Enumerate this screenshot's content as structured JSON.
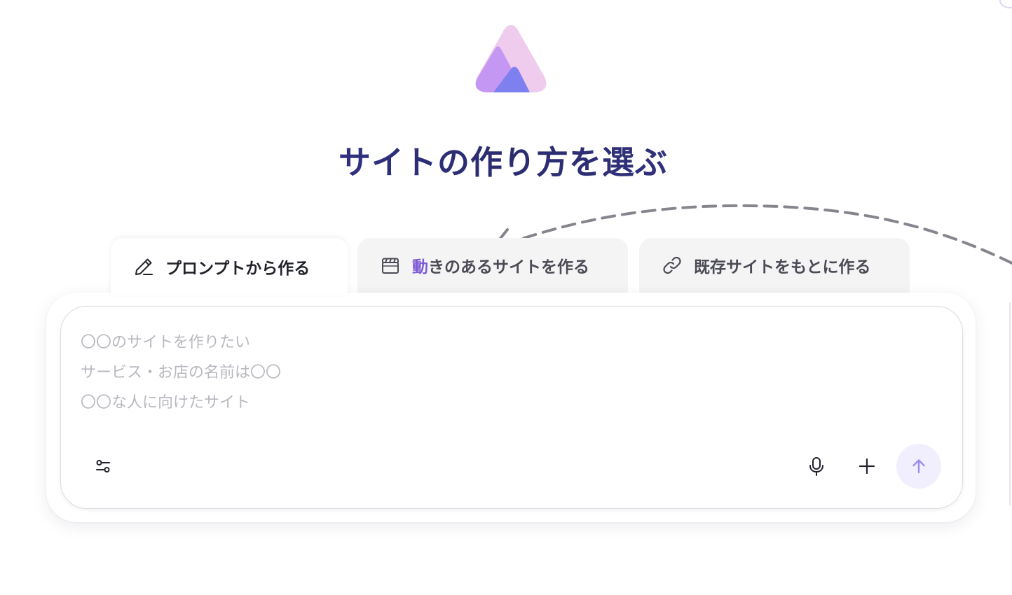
{
  "page": {
    "title": "サイトの作り方を選ぶ"
  },
  "tabs": [
    {
      "label": "プロンプトから作る",
      "icon": "pencil-icon",
      "active": true
    },
    {
      "label_accent": "動",
      "label_rest": "きのあるサイトを作る",
      "icon": "clapperboard-icon",
      "active": false
    },
    {
      "label": "既存サイトをもとに作る",
      "icon": "link-icon",
      "active": false
    }
  ],
  "composer": {
    "value": "",
    "placeholder": "〇〇のサイトを作りたい\nサービス・お店の名前は〇〇\n〇〇な人に向けたサイト",
    "buttons": {
      "settings": "sliders-icon",
      "mic": "microphone-icon",
      "add": "plus-icon",
      "send": "arrow-up-icon"
    }
  },
  "colors": {
    "title": "#2e2f7a",
    "accent": "#7d5ad8",
    "send_bg": "#f1effd",
    "send_icon": "#9b8cf0",
    "logo_light": "#efc9ec",
    "logo_mid": "#c497f2",
    "logo_dark": "#7f7ef0"
  }
}
